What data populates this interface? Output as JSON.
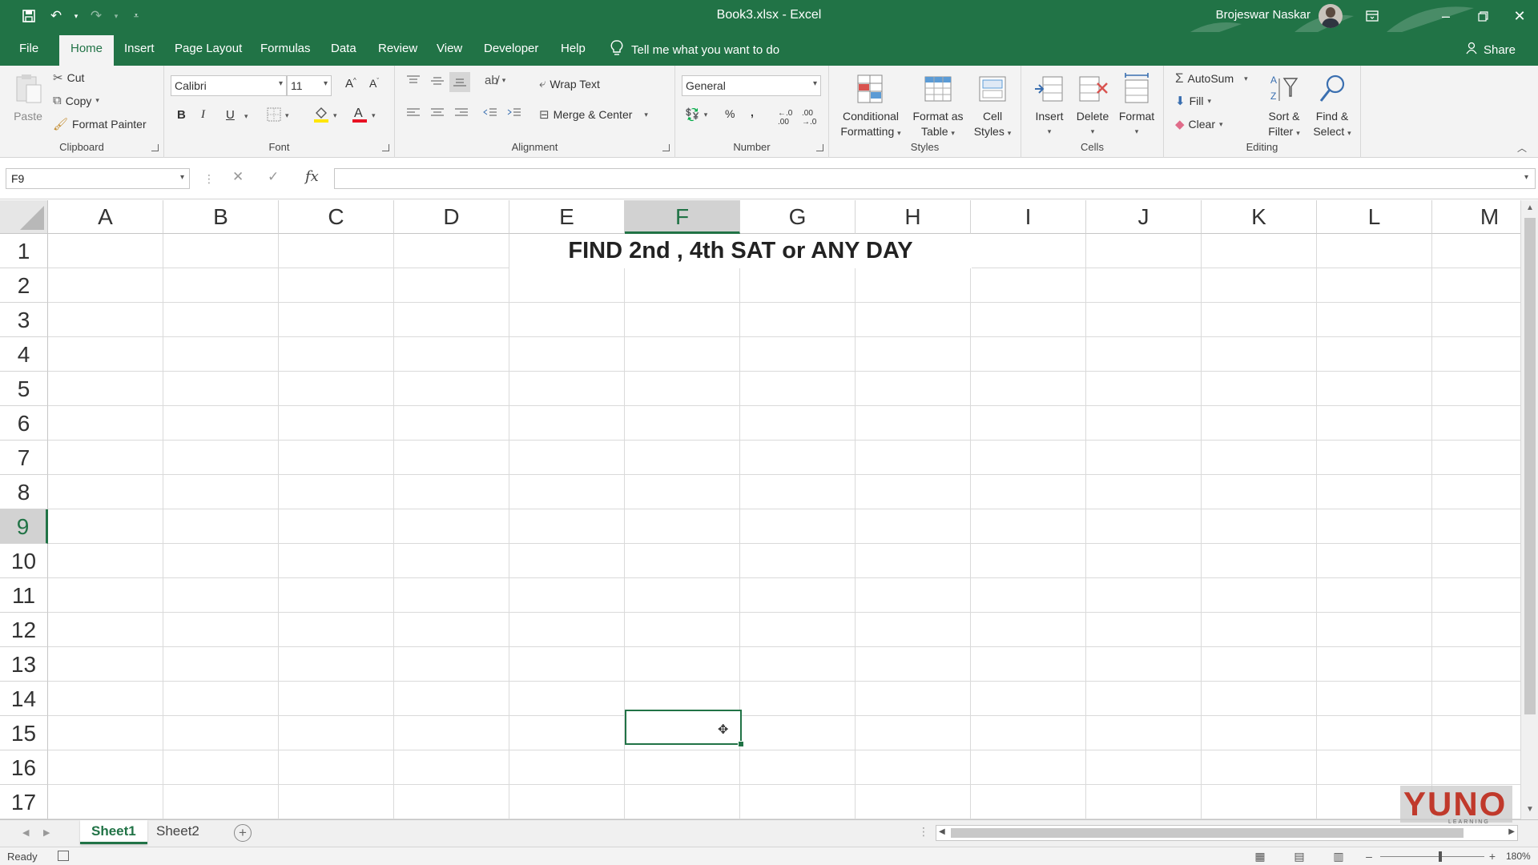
{
  "window": {
    "title": "Book3.xlsx  -  Excel",
    "user": "Brojeswar Naskar",
    "accent": "#217346"
  },
  "quick_access": {
    "save_icon": "save-icon",
    "undo_icon": "undo-icon",
    "redo_icon": "redo-icon",
    "customize_icon": "customize-qat-icon"
  },
  "tabs": {
    "items": [
      "File",
      "Home",
      "Insert",
      "Page Layout",
      "Formulas",
      "Data",
      "Review",
      "View",
      "Developer",
      "Help"
    ],
    "active": "Home",
    "tell_me": "Tell me what you want to do",
    "share": "Share"
  },
  "ribbon": {
    "clipboard": {
      "paste": "Paste",
      "cut": "Cut",
      "copy": "Copy",
      "format_painter": "Format Painter",
      "label": "Clipboard"
    },
    "font": {
      "name": "Calibri",
      "size": "11",
      "bold": "B",
      "italic": "I",
      "underline": "U",
      "label": "Font",
      "fill_color": "#ffe600",
      "font_color": "#e81123"
    },
    "alignment": {
      "wrap_text": "Wrap Text",
      "merge_center": "Merge & Center",
      "label": "Alignment"
    },
    "number": {
      "format": "General",
      "percent": "%",
      "comma": ",",
      "label": "Number"
    },
    "styles": {
      "conditional": [
        "Conditional",
        "Formatting"
      ],
      "format_table": [
        "Format as",
        "Table"
      ],
      "cell_styles": [
        "Cell",
        "Styles"
      ],
      "label": "Styles"
    },
    "cells": {
      "insert": "Insert",
      "delete": "Delete",
      "format": "Format",
      "label": "Cells"
    },
    "editing": {
      "autosum": "AutoSum",
      "fill": "Fill",
      "clear": "Clear",
      "sort_filter": [
        "Sort &",
        "Filter"
      ],
      "find_select": [
        "Find &",
        "Select"
      ],
      "label": "Editing"
    }
  },
  "formula_bar": {
    "name_box": "F9",
    "fx": "fx",
    "content": ""
  },
  "grid": {
    "columns": [
      "A",
      "B",
      "C",
      "D",
      "E",
      "F",
      "G",
      "H",
      "I",
      "J",
      "K",
      "L",
      "M"
    ],
    "rows": [
      "1",
      "2",
      "3",
      "4",
      "5",
      "6",
      "7",
      "8",
      "9",
      "10",
      "11",
      "12",
      "13",
      "14",
      "15",
      "16",
      "17"
    ],
    "selected_column": "F",
    "selected_row": "9",
    "title_text": "FIND 2nd , 4th SAT or ANY DAY"
  },
  "sheets": {
    "tabs": [
      "Sheet1",
      "Sheet2"
    ],
    "active": "Sheet1"
  },
  "status": {
    "ready": "Ready",
    "zoom": "180%"
  },
  "watermark": {
    "text": "YUNO",
    "sub": "LEARNING"
  }
}
